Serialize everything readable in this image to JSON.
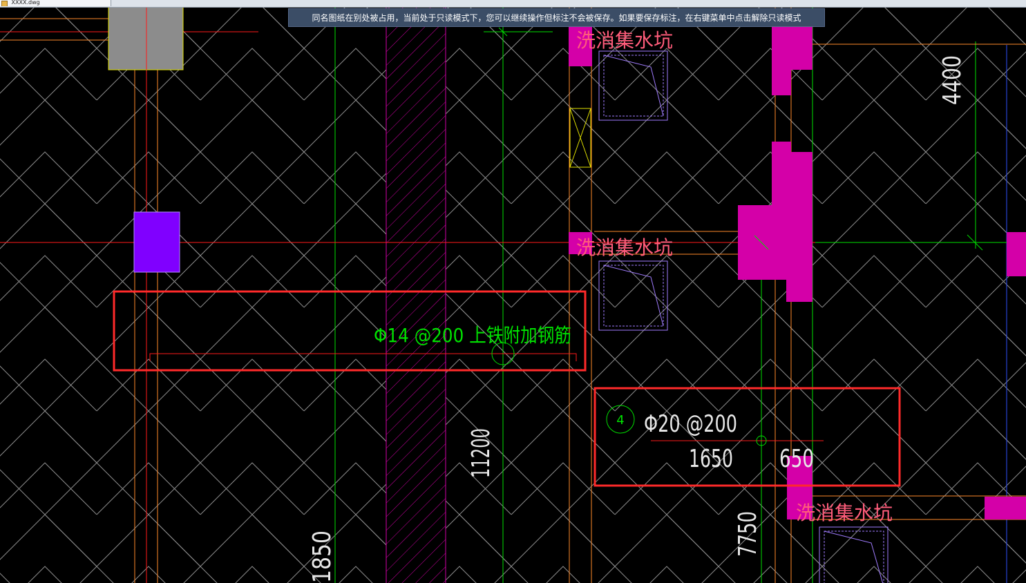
{
  "app": {
    "tab_label": "XXXX.dwg",
    "readonly_banner": "同名图纸在别处被占用，当前处于只读模式下，您可以继续操作但标注不会被保存。如果要保存标注，在右键菜单中点击解除只读模式"
  },
  "drawing": {
    "pit_labels": [
      "洗消集水坑",
      "洗消集水坑",
      "洗消集水坑"
    ],
    "rebar_note_top": "Φ14 @200  上铁附加钢筋",
    "rebar_note_bottom": "Φ20 @200",
    "bubble_number": "4",
    "dimensions": {
      "d1650": "1650",
      "d650": "650",
      "d11200": "11200",
      "d7750": "7750",
      "d4400": "4400",
      "d1850": "1850"
    }
  },
  "colors": {
    "background": "#000000",
    "hatch": "#8c8c8c",
    "green": "#00e000",
    "red": "#ff1a1a",
    "magenta": "#d400a8",
    "violet": "#8000ff",
    "yellow": "#e0e000",
    "orange": "#ff8a2a",
    "pink_text": "#ff5c7a",
    "lavender": "#a07cff",
    "white": "#e8e8e8",
    "markup_red": "#ff2a2a"
  }
}
